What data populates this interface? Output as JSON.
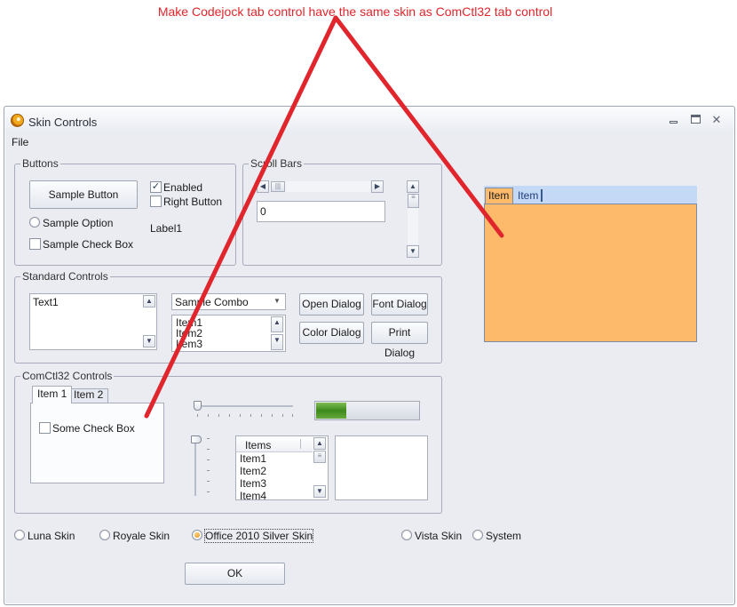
{
  "annotation": {
    "text": "Make Codejock tab control have the same skin as ComCtl32 tab control",
    "color": "#e0262c"
  },
  "window": {
    "title": "Skin Controls",
    "icon": "app-icon",
    "menu": {
      "file": "File"
    }
  },
  "buttons_group": {
    "legend": "Buttons",
    "sample_button": "Sample Button",
    "sample_option": "Sample Option",
    "sample_check": "Sample Check Box",
    "enabled": {
      "label": "Enabled",
      "checked": true
    },
    "right_button": {
      "label": "Right Button",
      "checked": false
    },
    "label1": "Label1"
  },
  "scroll_group": {
    "legend": "Scroll Bars",
    "edit_value": "0"
  },
  "standard_group": {
    "legend": "Standard Controls",
    "text1": "Text1",
    "combo_value": "Sample Combo",
    "list_items": [
      "Item1",
      "Item2",
      "Item3"
    ],
    "open_dialog": "Open Dialog",
    "font_dialog": "Font Dialog",
    "color_dialog": "Color Dialog",
    "print_dialog": "Print Dialog"
  },
  "comctl_group": {
    "legend": "ComCtl32 Controls",
    "tabs": [
      "Item 1",
      "Item 2"
    ],
    "check_box": "Some Check Box",
    "progress_fraction": 0.29,
    "listview_header": "Items",
    "listview_items": [
      "Item1",
      "Item2",
      "Item3",
      "Item4"
    ]
  },
  "codejock_tabs": [
    "Item",
    "Item"
  ],
  "skins": [
    {
      "label": "Luna Skin",
      "selected": false
    },
    {
      "label": "Royale Skin",
      "selected": false
    },
    {
      "label": "Office 2010 Silver Skin",
      "selected": true
    },
    {
      "label": "Vista Skin",
      "selected": false
    },
    {
      "label": "System",
      "selected": false
    }
  ],
  "ok_button": "OK",
  "colors": {
    "accent_orange": "#fdba6a",
    "codejock_tabbar": "#c3d9f5",
    "annotation_red": "#e0262c",
    "progress_green": "#4f9a28"
  }
}
